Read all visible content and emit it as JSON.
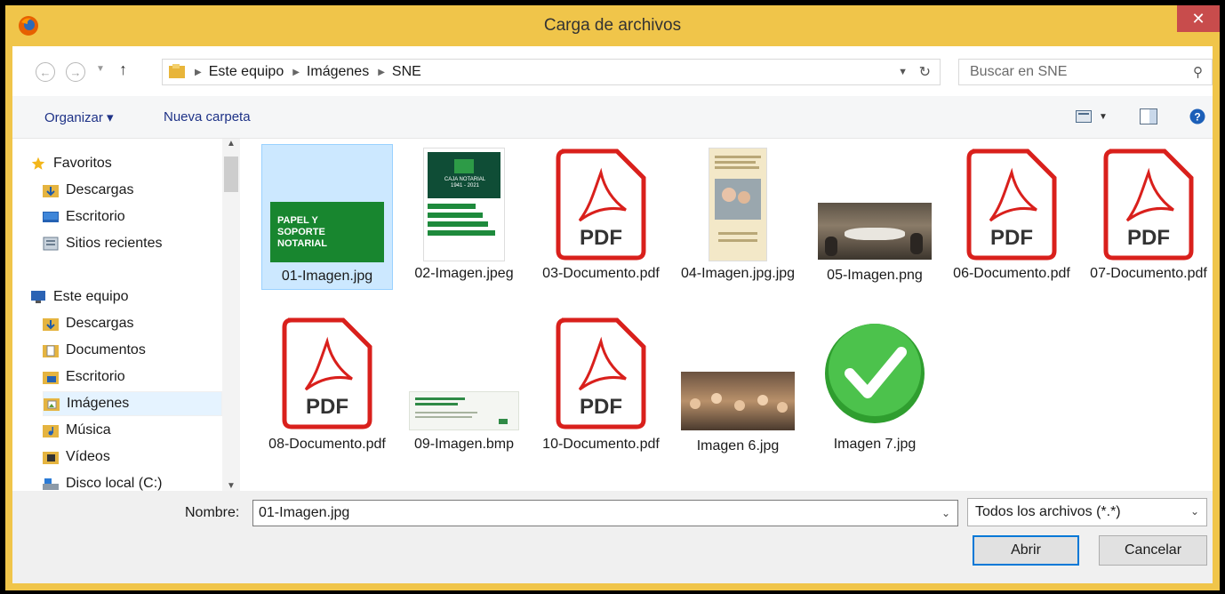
{
  "window": {
    "title": "Carga de archivos",
    "close_label": "✕"
  },
  "address": {
    "breadcrumbs": [
      "Este equipo",
      "Imágenes",
      "SNE"
    ],
    "search_placeholder": "Buscar en SNE"
  },
  "toolbar": {
    "organize_label": "Organizar ▾",
    "new_folder_label": "Nueva carpeta"
  },
  "nav": {
    "favorites": "Favoritos",
    "fav_items": [
      "Descargas",
      "Escritorio",
      "Sitios recientes"
    ],
    "this_pc": "Este equipo",
    "pc_items": [
      "Descargas",
      "Documentos",
      "Escritorio",
      "Imágenes",
      "Música",
      "Vídeos",
      "Disco local (C:)"
    ],
    "selected": "Imágenes"
  },
  "files": [
    {
      "name": "01-Imagen.jpg",
      "kind": "green-banner",
      "thumb_text": "PAPEL Y\nSOPORTE\nNOTARIAL",
      "selected": true
    },
    {
      "name": "02-Imagen.jpeg",
      "kind": "poster",
      "thumb_text": "CAJA NOTARIAL\n1941 - 2021"
    },
    {
      "name": "03-Documento.pdf",
      "kind": "pdf",
      "thumb_text": "PDF"
    },
    {
      "name": "04-Imagen.jpg.jpg",
      "kind": "photo-flyer"
    },
    {
      "name": "05-Imagen.png",
      "kind": "photo-meeting"
    },
    {
      "name": "06-Documento.pdf",
      "kind": "pdf",
      "thumb_text": "PDF"
    },
    {
      "name": "07-Documento.pdf",
      "kind": "pdf",
      "thumb_text": "PDF"
    },
    {
      "name": "08-Documento.pdf",
      "kind": "pdf",
      "thumb_text": "PDF"
    },
    {
      "name": "09-Imagen.bmp",
      "kind": "card"
    },
    {
      "name": "10-Documento.pdf",
      "kind": "pdf",
      "thumb_text": "PDF"
    },
    {
      "name": "Imagen 6.jpg",
      "kind": "photo-crowd"
    },
    {
      "name": "Imagen 7.jpg",
      "kind": "checkmark"
    }
  ],
  "bottom": {
    "name_label": "Nombre:",
    "name_value": "01-Imagen.jpg",
    "type_value": "Todos los archivos (*.*)",
    "open_label": "Abrir",
    "cancel_label": "Cancelar"
  },
  "colors": {
    "title_bar": "#f0c54a",
    "close": "#c84c4c",
    "pdf_red": "#d9201c",
    "selection": "#cce8ff"
  }
}
